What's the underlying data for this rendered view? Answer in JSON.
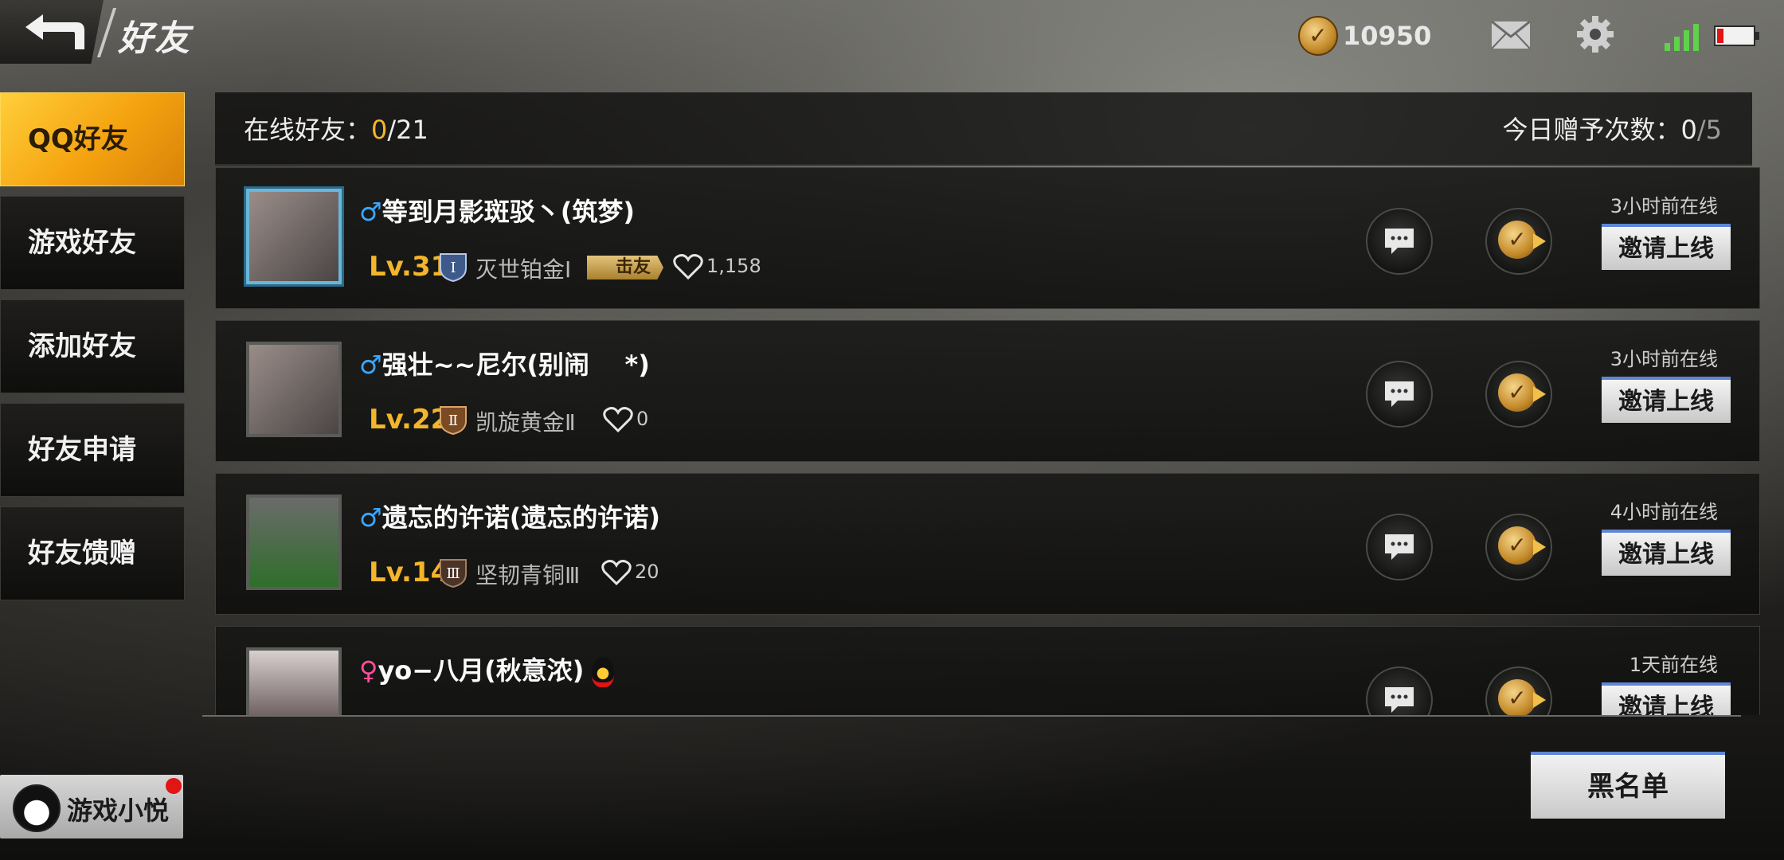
{
  "header": {
    "title": "好友",
    "coins": "10950",
    "coin_symbol": "✓"
  },
  "sidebar": {
    "items": [
      {
        "label": "QQ好友",
        "active": true
      },
      {
        "label": "游戏好友",
        "active": false
      },
      {
        "label": "添加好友",
        "active": false
      },
      {
        "label": "好友申请",
        "active": false
      },
      {
        "label": "好友馈赠",
        "active": false
      }
    ],
    "assistant_label": "游戏小悦"
  },
  "panel": {
    "online_label": "在线好友：",
    "online_count": "0",
    "online_total": "/21",
    "gift_label": "今日赠予次数：",
    "gift_count": "0",
    "gift_total": "/5"
  },
  "friends": [
    {
      "gender": "♂",
      "name": "等到月影斑驳丶(筑梦)",
      "level": "Lv.31",
      "rank": "灭世铂金Ⅰ",
      "rank_numeral": "Ⅰ",
      "tag": "击友",
      "likes": "1,158",
      "status": "3小时前在线",
      "invite": "邀请上线"
    },
    {
      "gender": "♂",
      "name": "强壮~~尼尔(别闹    *)",
      "level": "Lv.22",
      "rank": "凯旋黄金Ⅱ",
      "rank_numeral": "Ⅱ",
      "likes": "0",
      "status": "3小时前在线",
      "invite": "邀请上线"
    },
    {
      "gender": "♂",
      "name": "遗忘的许诺(遗忘的许诺)",
      "level": "Lv.14",
      "rank": "坚韧青铜Ⅲ",
      "rank_numeral": "Ⅲ",
      "likes": "20",
      "status": "4小时前在线",
      "invite": "邀请上线"
    },
    {
      "gender": "♀",
      "name": "yo−八月(秋意浓)",
      "status": "1天前在线",
      "invite": "邀请上线"
    }
  ],
  "footer": {
    "blacklist": "黑名单"
  },
  "colors": {
    "accent_gold": "#f3b52a",
    "male": "#3aa7ff",
    "female": "#ff4f9a",
    "button_border": "#5f86d6"
  }
}
